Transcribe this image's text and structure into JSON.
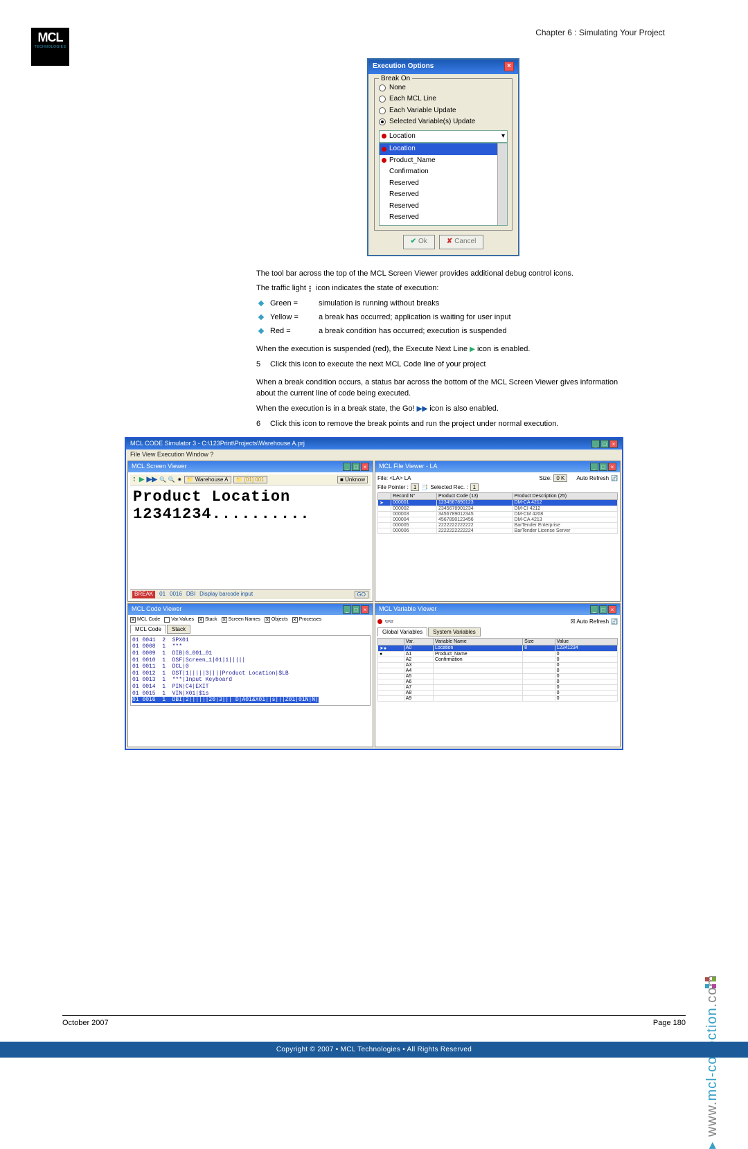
{
  "chapter_header": "Chapter 6 : Simulating Your Project",
  "logo": {
    "main": "MCL",
    "sub": "TECHNOLOGIES"
  },
  "exec_dialog": {
    "title": "Execution Options",
    "group_label": "Break On",
    "options": [
      "None",
      "Each MCL Line",
      "Each Variable Update",
      "Selected Variable(s) Update"
    ],
    "selected_option_idx": 3,
    "dropdown_value": "Location",
    "dropdown_items": [
      "Location",
      "Product_Name",
      "Confirmation",
      "Reserved",
      "Reserved",
      "Reserved",
      "Reserved",
      "Reserved",
      "Reserved"
    ],
    "ok_label": "Ok",
    "cancel_label": "Cancel"
  },
  "body": {
    "p1": "The tool bar across the top of the MCL Screen Viewer provides additional debug control icons.",
    "p2_pre": "The traffic light ",
    "p2_post": " icon indicates the state of execution:",
    "lights": [
      {
        "label": "Green =",
        "desc": "simulation is running without breaks"
      },
      {
        "label": "Yellow =",
        "desc": "a break has occurred; application is waiting for user input"
      },
      {
        "label": "Red =",
        "desc": "a break condition has occurred; execution is suspended"
      }
    ],
    "p3_pre": "When the execution is suspended (red), the Execute Next Line ",
    "p3_post": " icon is enabled.",
    "step5_n": "5",
    "step5_t": "Click this icon to execute the next MCL Code line of your project",
    "p4": "When a break condition occurs, a status bar across the bottom of the MCL Screen Viewer gives information about the current line of code being executed.",
    "p5_pre": "When the execution is in a break state, the Go! ",
    "p5_post": " icon is also enabled.",
    "step6_n": "6",
    "step6_t": "Click this icon to remove the break points and run the project under normal execution."
  },
  "sim": {
    "window_title": "MCL CODE Simulator 3 - C:\\123Print\\Projects\\Warehouse A.prj",
    "menu": "File  View  Execution  Window  ?",
    "screen_viewer": {
      "title": "MCL Screen Viewer",
      "toolbar_app": "Warehouse A",
      "toolbar_folder": "[01] 001",
      "toolbar_status": "Unknow",
      "line1": "Product Location",
      "line2": "12341234..........",
      "status": {
        "red": "BREAK",
        "c1": "01",
        "c2": "0016",
        "c3": "DBI",
        "c4": "Display barcode input",
        "c5": "GO"
      }
    },
    "file_viewer": {
      "title": "MCL File Viewer - LA",
      "topbar_file": "File:  <LA> LA",
      "topbar_size": "Size:",
      "topbar_size_val": "0 K",
      "topbar_auto": "Auto Refresh",
      "pointer_label": "File Pointer :",
      "pointer_val": "1",
      "sel_label": "Selected Rec. :",
      "sel_val": "1",
      "cols": [
        "Record N°",
        "Product Code (13)",
        "Product Description (25)"
      ],
      "rows": [
        [
          "000001",
          "1234567890123",
          "DM-CA 4212"
        ],
        [
          "000002",
          "2345678901234",
          "DM-CI 4212"
        ],
        [
          "000003",
          "3456789012345",
          "DM-CM 4208"
        ],
        [
          "000004",
          "4567890123456",
          "DM-CA 4213"
        ],
        [
          "000005",
          "2222222222222",
          "BarTender Enterprise"
        ],
        [
          "000006",
          "2222222222224",
          "BarTender License Server"
        ]
      ]
    },
    "code_viewer": {
      "title": "MCL Code Viewer",
      "filters": [
        "MCL Code",
        "Var.Values",
        "Stack",
        "Screen Names",
        "Objects",
        "Processes"
      ],
      "tabs": [
        "MCL Code",
        "Stack"
      ],
      "lines": [
        "01 0041  2  SPX01",
        "01 0008  1  ***",
        "01 0009  1  DIB|0_001_01",
        "01 0010  1  DSF|Screen_1|01|1|||||",
        "01 0011  1  DCL|0",
        "01 0012  1  DST|1|||||3||||Product Location|$LB",
        "01 0013  1  ***|Input Keyboard",
        "01 0014  1  PIN|C4|EXIT",
        "01 0015  1  VIN|X01|$1s",
        "01 0016  1  DBI|2||||||20|3||| D|A01&X01||s|||Z01|01N|N|"
      ]
    },
    "var_viewer": {
      "title": "MCL Variable Viewer",
      "filter_auto": "Auto Refresh",
      "tabs": [
        "Global Variables",
        "System Variables"
      ],
      "cols": [
        "",
        "Var.",
        "Variable Name",
        "Size",
        "Value"
      ],
      "rows": [
        [
          "A0",
          "Location",
          "8",
          "12341234"
        ],
        [
          "A1",
          "Product_Name",
          "",
          "0"
        ],
        [
          "A2",
          "Confirmation",
          "",
          "0"
        ],
        [
          "A3",
          "",
          "",
          "0"
        ],
        [
          "A4",
          "",
          "",
          "0"
        ],
        [
          "A5",
          "",
          "",
          "0"
        ],
        [
          "A6",
          "",
          "",
          "0"
        ],
        [
          "A7",
          "",
          "",
          "0"
        ],
        [
          "A8",
          "",
          "",
          "0"
        ],
        [
          "A9",
          "",
          "",
          "0"
        ]
      ]
    }
  },
  "side_url": {
    "w": "www.",
    "b": "mcl-collection",
    "c": ".com"
  },
  "footer": {
    "left": "October 2007",
    "right": "Page 180"
  },
  "copyright": "Copyright © 2007 • MCL Technologies • All Rights Reserved"
}
